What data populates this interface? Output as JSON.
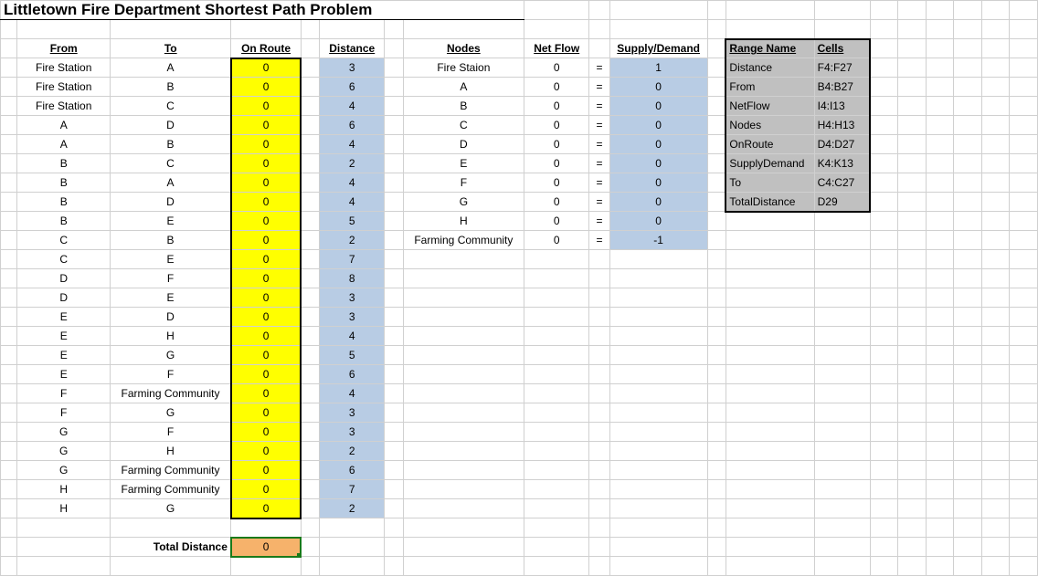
{
  "title": "Littletown Fire Department Shortest Path Problem",
  "headers": {
    "from": "From",
    "to": "To",
    "onroute": "On Route",
    "distance": "Distance",
    "nodes": "Nodes",
    "netflow": "Net Flow",
    "supplydemand": "Supply/Demand",
    "rangename": "Range Name",
    "cells": "Cells"
  },
  "arcs": [
    {
      "from": "Fire Station",
      "to": "A",
      "onroute": 0,
      "dist": 3
    },
    {
      "from": "Fire Station",
      "to": "B",
      "onroute": 0,
      "dist": 6
    },
    {
      "from": "Fire Station",
      "to": "C",
      "onroute": 0,
      "dist": 4
    },
    {
      "from": "A",
      "to": "D",
      "onroute": 0,
      "dist": 6
    },
    {
      "from": "A",
      "to": "B",
      "onroute": 0,
      "dist": 4
    },
    {
      "from": "B",
      "to": "C",
      "onroute": 0,
      "dist": 2
    },
    {
      "from": "B",
      "to": "A",
      "onroute": 0,
      "dist": 4
    },
    {
      "from": "B",
      "to": "D",
      "onroute": 0,
      "dist": 4
    },
    {
      "from": "B",
      "to": "E",
      "onroute": 0,
      "dist": 5
    },
    {
      "from": "C",
      "to": "B",
      "onroute": 0,
      "dist": 2
    },
    {
      "from": "C",
      "to": "E",
      "onroute": 0,
      "dist": 7
    },
    {
      "from": "D",
      "to": "F",
      "onroute": 0,
      "dist": 8
    },
    {
      "from": "D",
      "to": "E",
      "onroute": 0,
      "dist": 3
    },
    {
      "from": "E",
      "to": "D",
      "onroute": 0,
      "dist": 3
    },
    {
      "from": "E",
      "to": "H",
      "onroute": 0,
      "dist": 4
    },
    {
      "from": "E",
      "to": "G",
      "onroute": 0,
      "dist": 5
    },
    {
      "from": "E",
      "to": "F",
      "onroute": 0,
      "dist": 6
    },
    {
      "from": "F",
      "to": "Farming Community",
      "onroute": 0,
      "dist": 4
    },
    {
      "from": "F",
      "to": "G",
      "onroute": 0,
      "dist": 3
    },
    {
      "from": "G",
      "to": "F",
      "onroute": 0,
      "dist": 3
    },
    {
      "from": "G",
      "to": "H",
      "onroute": 0,
      "dist": 2
    },
    {
      "from": "G",
      "to": "Farming Community",
      "onroute": 0,
      "dist": 6
    },
    {
      "from": "H",
      "to": "Farming Community",
      "onroute": 0,
      "dist": 7
    },
    {
      "from": "H",
      "to": "G",
      "onroute": 0,
      "dist": 2
    }
  ],
  "nodes": [
    {
      "name": "Fire Staion",
      "net": 0,
      "eq": "=",
      "sd": 1
    },
    {
      "name": "A",
      "net": 0,
      "eq": "=",
      "sd": 0
    },
    {
      "name": "B",
      "net": 0,
      "eq": "=",
      "sd": 0
    },
    {
      "name": "C",
      "net": 0,
      "eq": "=",
      "sd": 0
    },
    {
      "name": "D",
      "net": 0,
      "eq": "=",
      "sd": 0
    },
    {
      "name": "E",
      "net": 0,
      "eq": "=",
      "sd": 0
    },
    {
      "name": "F",
      "net": 0,
      "eq": "=",
      "sd": 0
    },
    {
      "name": "G",
      "net": 0,
      "eq": "=",
      "sd": 0
    },
    {
      "name": "H",
      "net": 0,
      "eq": "=",
      "sd": 0
    },
    {
      "name": "Farming Community",
      "net": 0,
      "eq": "=",
      "sd": -1
    }
  ],
  "ranges": [
    {
      "name": "Distance",
      "cells": "F4:F27"
    },
    {
      "name": "From",
      "cells": "B4:B27"
    },
    {
      "name": "NetFlow",
      "cells": "I4:I13"
    },
    {
      "name": "Nodes",
      "cells": "H4:H13"
    },
    {
      "name": "OnRoute",
      "cells": "D4:D27"
    },
    {
      "name": "SupplyDemand",
      "cells": "K4:K13"
    },
    {
      "name": "To",
      "cells": "C4:C27"
    },
    {
      "name": "TotalDistance",
      "cells": "D29"
    }
  ],
  "total": {
    "label": "Total Distance",
    "value": 0
  }
}
